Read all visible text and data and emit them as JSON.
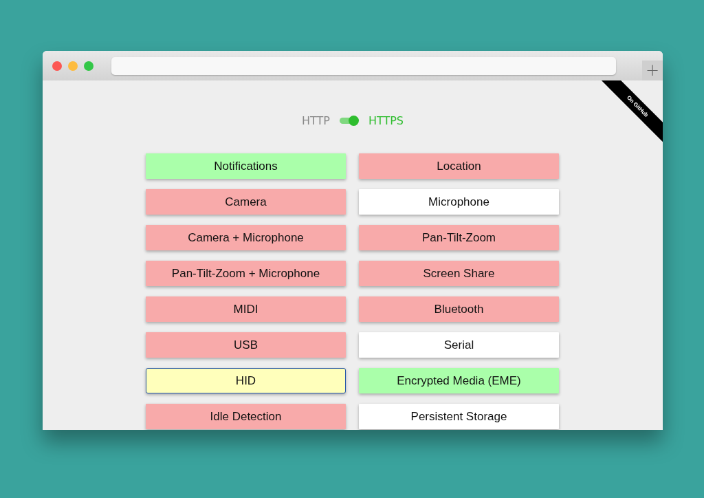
{
  "browser": {
    "new_tab_button": "+"
  },
  "ribbon": {
    "label": "On GitHub"
  },
  "protocol_toggle": {
    "off_label": "HTTP",
    "on_label": "HTTPS",
    "on": true
  },
  "permissions": [
    {
      "label": "Notifications",
      "color": "#aaffaa",
      "focused": false
    },
    {
      "label": "Location",
      "color": "#f8aaaa",
      "focused": false
    },
    {
      "label": "Camera",
      "color": "#f8aaaa",
      "focused": false
    },
    {
      "label": "Microphone",
      "color": "#ffffff",
      "focused": false
    },
    {
      "label": "Camera + Microphone",
      "color": "#f8aaaa",
      "focused": false
    },
    {
      "label": "Pan-Tilt-Zoom",
      "color": "#f8aaaa",
      "focused": false
    },
    {
      "label": "Pan-Tilt-Zoom + Microphone",
      "color": "#f8aaaa",
      "focused": false
    },
    {
      "label": "Screen Share",
      "color": "#f8aaaa",
      "focused": false
    },
    {
      "label": "MIDI",
      "color": "#f8aaaa",
      "focused": false
    },
    {
      "label": "Bluetooth",
      "color": "#f8aaaa",
      "focused": false
    },
    {
      "label": "USB",
      "color": "#f8aaaa",
      "focused": false
    },
    {
      "label": "Serial",
      "color": "#ffffff",
      "focused": false
    },
    {
      "label": "HID",
      "color": "#ffffbb",
      "focused": true
    },
    {
      "label": "Encrypted Media (EME)",
      "color": "#aaffaa",
      "focused": false
    },
    {
      "label": "Idle Detection",
      "color": "#f8aaaa",
      "focused": false
    },
    {
      "label": "Persistent Storage",
      "color": "#ffffff",
      "focused": false
    }
  ]
}
